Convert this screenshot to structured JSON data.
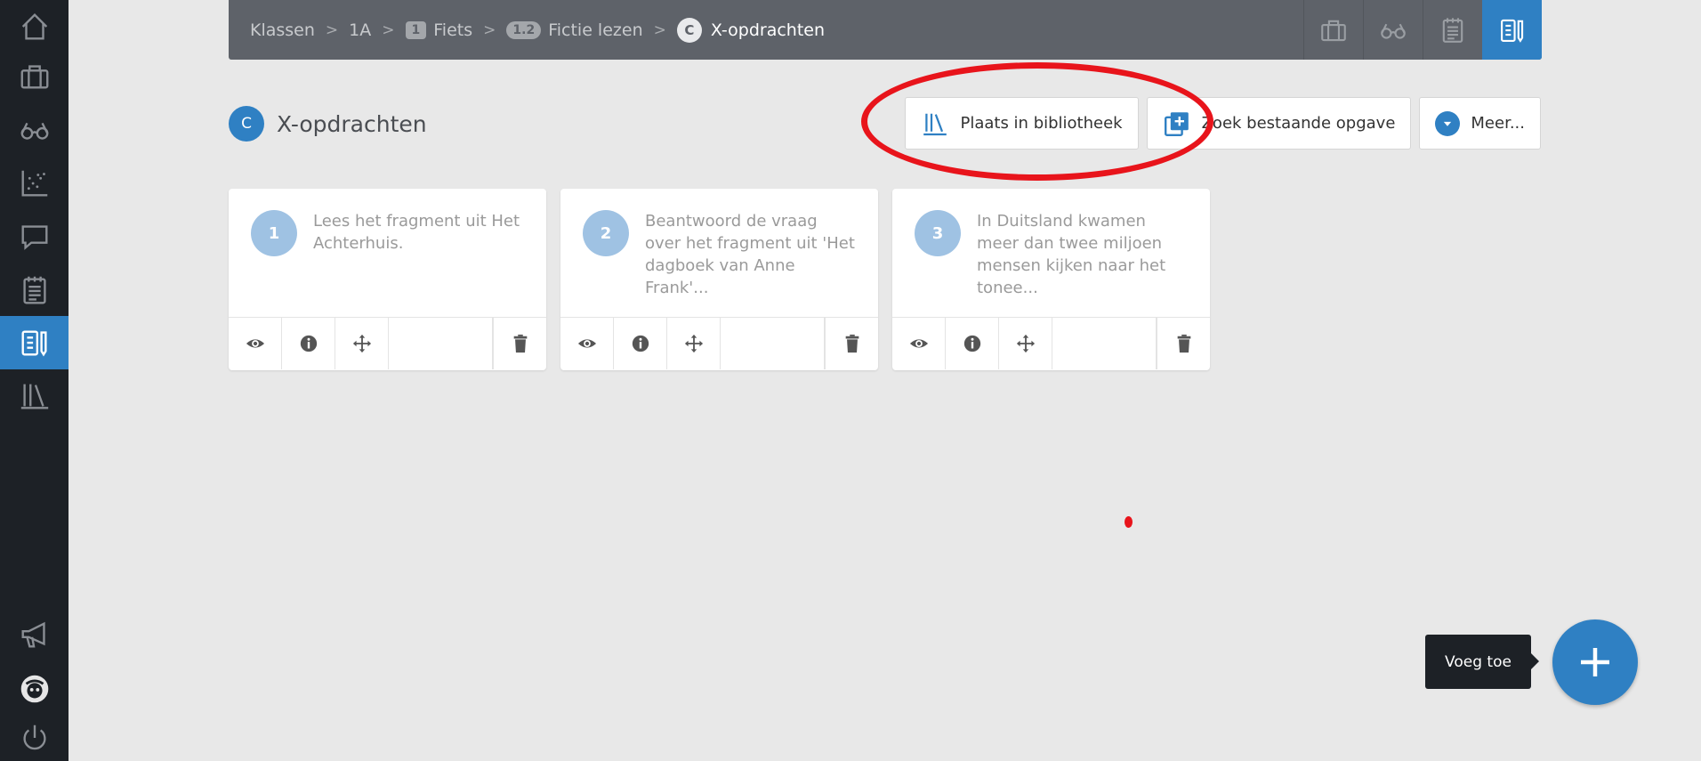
{
  "breadcrumb": {
    "items": [
      {
        "label": "Klassen"
      },
      {
        "label": "1A"
      },
      {
        "badge": "1",
        "label": "Fiets"
      },
      {
        "badge": "1.2",
        "label": "Fictie lezen"
      },
      {
        "badge": "C",
        "label": "X-opdrachten"
      }
    ]
  },
  "page": {
    "badge": "C",
    "title": "X-opdrachten"
  },
  "actions": {
    "library_label": "Plaats in bibliotheek",
    "search_label": "Zoek bestaande opgave",
    "more_label": "Meer..."
  },
  "cards": [
    {
      "number": "1",
      "text": "Lees het fragment uit Het Achterhuis."
    },
    {
      "number": "2",
      "text": "Beantwoord de vraag over het fragment uit 'Het dagboek van Anne Frank'..."
    },
    {
      "number": "3",
      "text": "In Duitsland kwamen meer dan twee miljoen mensen kijken naar het tonee..."
    }
  ],
  "fab": {
    "tooltip": "Voeg toe"
  },
  "colors": {
    "accent": "#2f80c3",
    "sidebar": "#1d2126",
    "topbar": "#5e6269",
    "annotation": "#e8141b"
  }
}
